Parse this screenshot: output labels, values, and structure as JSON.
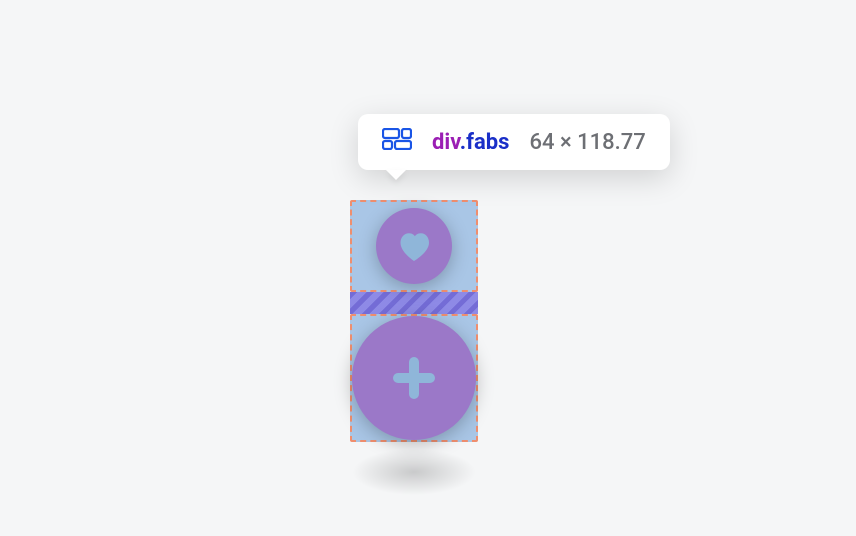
{
  "inspector": {
    "tag": "div",
    "class_display": ".fabs",
    "dims_display": "64 × 118.77"
  },
  "fabs": {
    "heart_name": "heart-fab",
    "plus_name": "add-fab"
  }
}
